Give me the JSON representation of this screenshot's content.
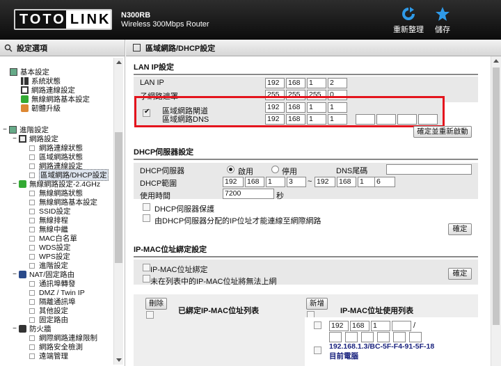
{
  "header": {
    "logo_left": "TOTO",
    "logo_right": "LINK",
    "model": "N300RB",
    "tagline": "Wireless 300Mbps Router",
    "refresh": "重新整理",
    "save": "儲存"
  },
  "sidebar": {
    "title": "設定選項",
    "items": [
      "基本設定",
      "系統狀態",
      "網路連線設定",
      "無線網路基本設定",
      "韌體升級",
      "進階設定",
      "網路設定",
      "網路連線狀態",
      "區域網路狀態",
      "網路連線設定",
      "區域網路/DHCP設定",
      "無線網路設定-2.4GHz",
      "無線網路狀態",
      "無線網路基本設定",
      "SSID設定",
      "無線排程",
      "無線中繼",
      "MAC白名單",
      "WDS設定",
      "WPS設定",
      "進階設定",
      "NAT/固定路由",
      "通訊埠轉發",
      "DMZ / Twin IP",
      "隔離通訊埠",
      "其他設定",
      "固定路由",
      "防火牆",
      "網際網路連線限制",
      "網路安全檢測",
      "遠端管理"
    ]
  },
  "main": {
    "title": "區域網路/DHCP設定",
    "lan": {
      "heading": "LAN IP設定",
      "ip_label": "LAN IP",
      "ip": [
        "192",
        "168",
        "1",
        "2"
      ],
      "mask_label": "子網路遮罩",
      "mask": [
        "255",
        "255",
        "255",
        "0"
      ],
      "gw_label": "區域網路閘道",
      "gw": [
        "192",
        "168",
        "1",
        "1"
      ],
      "dns_label": "區域網路DNS",
      "dns": [
        "192",
        "168",
        "1",
        "1"
      ],
      "dns2": [
        "",
        "",
        "",
        ""
      ],
      "apply": "確定並重新啟動"
    },
    "dhcp": {
      "heading": "DHCP伺服器設定",
      "server_label": "DHCP伺服器",
      "enable": "啟用",
      "disable": "停用",
      "dns_suffix_label": "DNS尾碼",
      "dns_suffix": "",
      "range_label": "DHCP範圍",
      "range_start": [
        "192",
        "168",
        "1",
        "3"
      ],
      "tilde": "~",
      "range_end": [
        "192",
        "168",
        "1",
        "6"
      ],
      "lease_label": "使用時間",
      "lease": "7200",
      "lease_unit": "秒",
      "guard": "DHCP伺服器保護",
      "restrict": "由DHCP伺服器分配的IP位址才能連線至網際網路",
      "ok": "確定"
    },
    "ipmac": {
      "heading": "IP-MAC位址綁定設定",
      "bind": "IP-MAC位址綁定",
      "block": "未在列表中的IP-MAC位址將無法上網",
      "ok": "確定",
      "delete": "刪除",
      "bound_list": "已綁定IP-MAC位址列表",
      "add": "新增",
      "used_list": "IP-MAC位址使用列表",
      "entry": [
        "192",
        "168",
        "1",
        ""
      ],
      "slash": "/",
      "mac": [
        "",
        "",
        "",
        "",
        "",
        ""
      ],
      "device": "192.168.1.3/BC-5F-F4-91-5F-18",
      "current": "目前電腦"
    }
  }
}
